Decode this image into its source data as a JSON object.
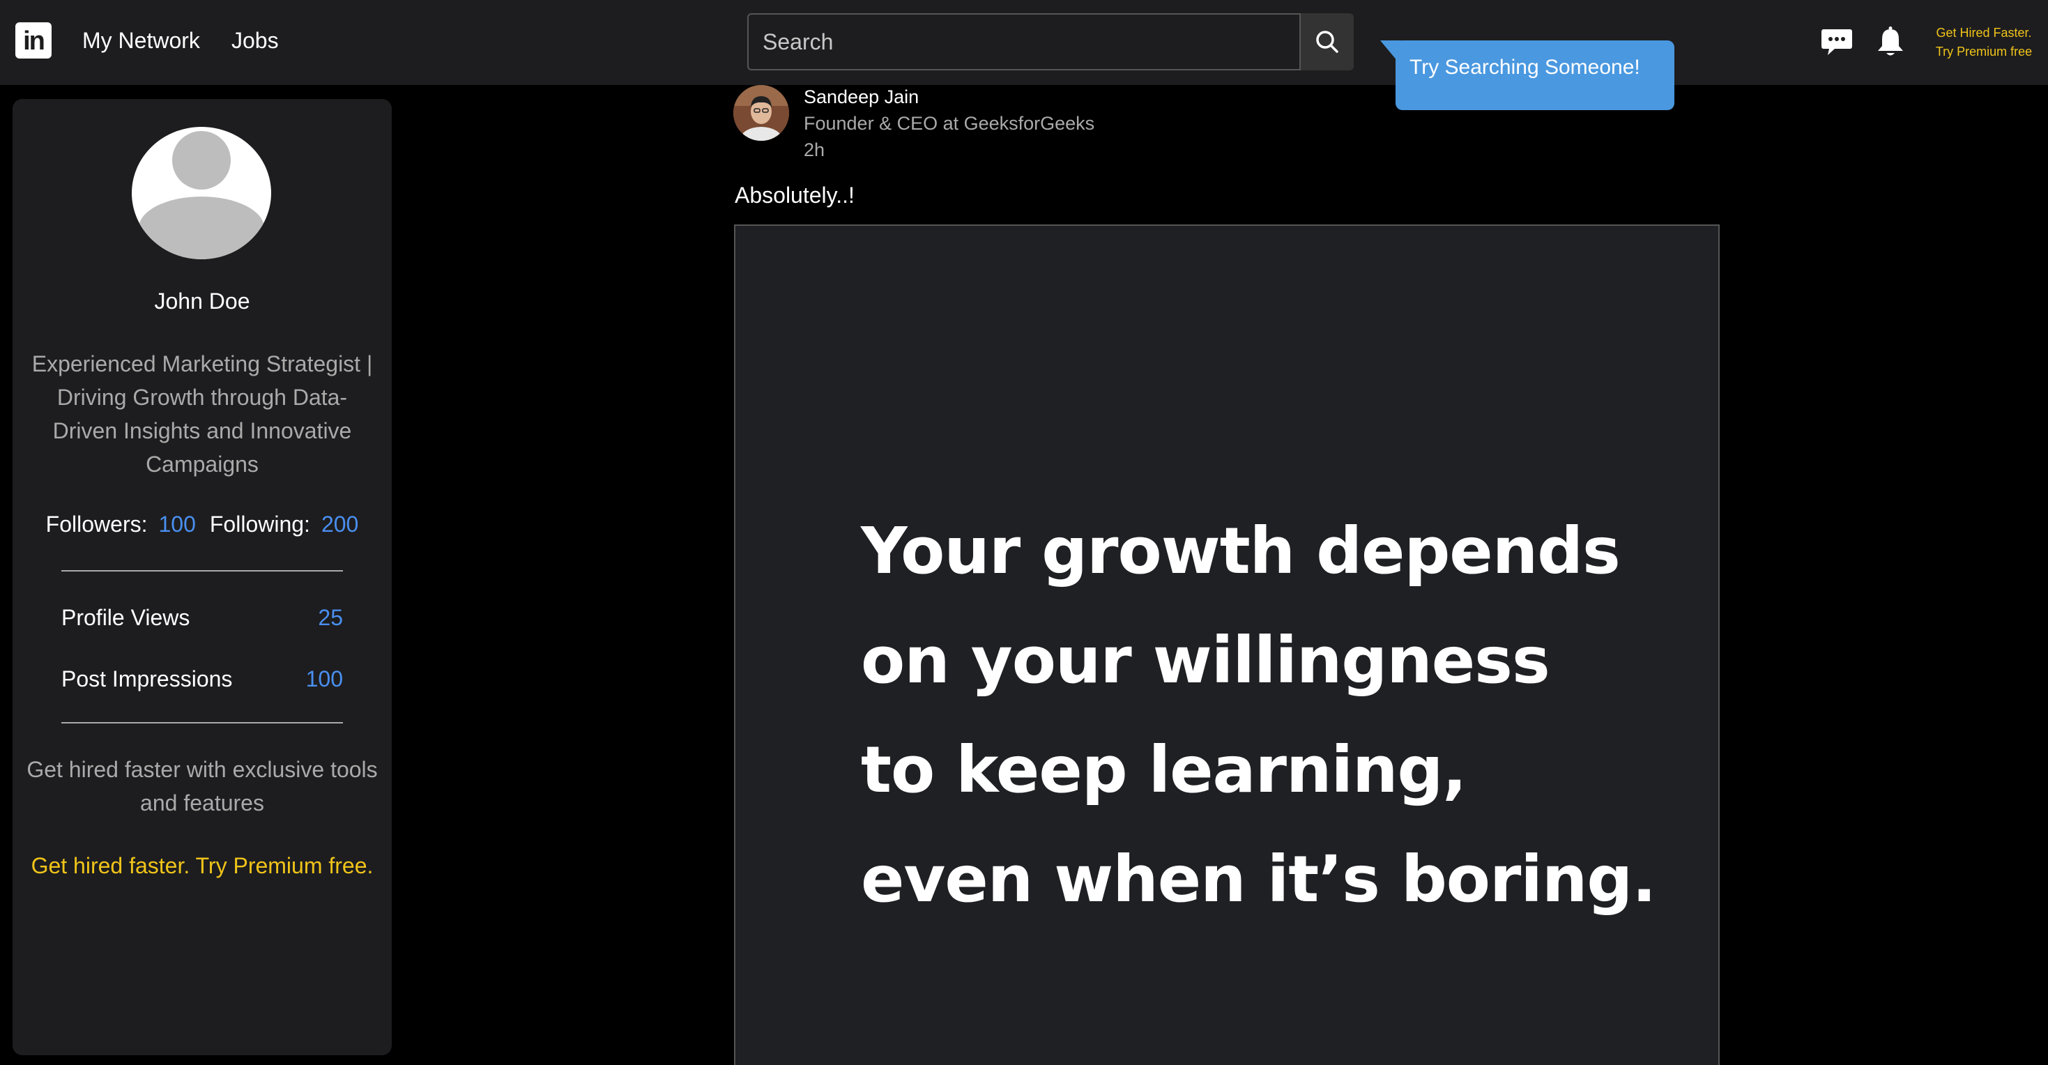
{
  "header": {
    "logo_text": "in",
    "nav": [
      {
        "label": "My Network"
      },
      {
        "label": "Jobs"
      }
    ],
    "search": {
      "placeholder": "Search",
      "value": ""
    },
    "tooltip": "Try Searching Someone!",
    "premium_line1": "Get Hired Faster.",
    "premium_line2": "Try Premium free"
  },
  "profile": {
    "name": "John Doe",
    "headline": "Experienced Marketing Strategist | Driving Growth through Data-Driven Insights and Innovative Campaigns",
    "followers_label": "Followers:",
    "followers": "100",
    "following_label": "Following:",
    "following": "200",
    "stats": [
      {
        "label": "Profile Views",
        "value": "25"
      },
      {
        "label": "Post Impressions",
        "value": "100"
      }
    ],
    "promo_text": "Get hired faster with exclusive tools and features",
    "promo_link": "Get hired faster. Try Premium free."
  },
  "post": {
    "author": "Sandeep Jain",
    "author_title": "Founder & CEO at GeeksforGeeks",
    "time": "2h",
    "text": "Absolutely..!",
    "image_quote": [
      "Your growth depends",
      "on your willingness",
      "to keep learning,",
      "even when it’s boring."
    ]
  },
  "colors": {
    "background": "#000000",
    "panel": "#1d1d1f",
    "accent_link": "#4a8ff0",
    "premium": "#f0c419",
    "tooltip": "#4a98e0"
  },
  "icons": [
    "linkedin-logo",
    "search-icon",
    "message-icon",
    "bell-icon",
    "avatar-placeholder-icon"
  ]
}
